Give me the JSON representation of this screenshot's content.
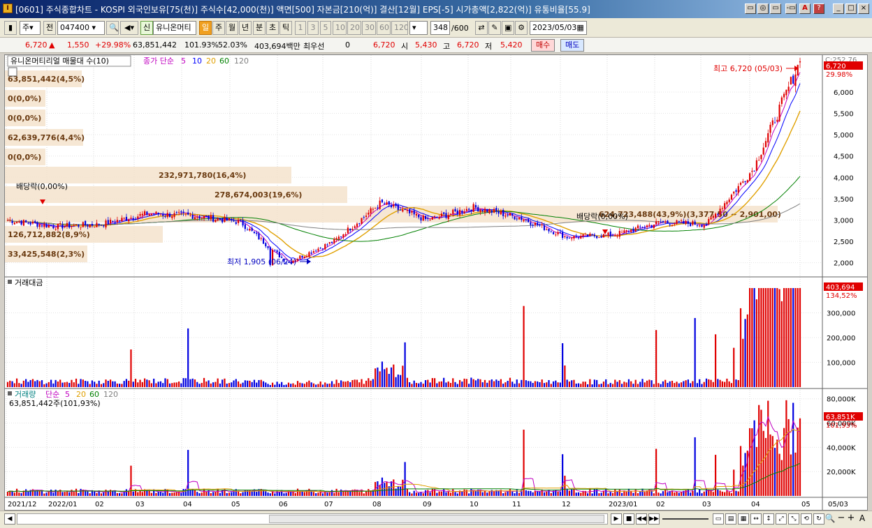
{
  "window": {
    "icon_label": "I",
    "title": "[0601] 주식종합차트 - KOSPI 외국인보유[75(천)] 주식수[42,000(천)] 액면[500] 자본금[210(억)] 결산[12월] EPS[-5] 시가총액[2,822(억)] 유통비율[55.9]",
    "buttons": [
      "▭",
      "◎",
      "▭",
      "-▭",
      "A",
      "?",
      "_",
      "□",
      "×"
    ]
  },
  "toolbar": {
    "stock_type": "주",
    "market": "전",
    "code": "047400",
    "stock_name_tag": "신",
    "stock_name": "유니온머티",
    "periods": [
      "일",
      "주",
      "월",
      "년",
      "분",
      "초",
      "틱"
    ],
    "selected_period": "일",
    "intervals": [
      "1",
      "3",
      "5",
      "10",
      "20",
      "30",
      "60",
      "120"
    ],
    "count": "348",
    "max_count": "/600",
    "date": "2023/05/03"
  },
  "quote": {
    "price": "6,720",
    "arrow": "▲",
    "change": "1,550",
    "change_pct": "+29.98%",
    "volume": "63,851,442",
    "vol_ratio": "101.93%",
    "turnover_ratio": "52.03%",
    "trade_value": "403,694백만",
    "prefer_label": "최우선",
    "prefer_value": "0",
    "best_ask": "6,720",
    "open_label": "시",
    "open": "5,430",
    "high_label": "고",
    "high": "6,720",
    "low_label": "저",
    "low": "5,420",
    "buy_label": "매수",
    "sell_label": "매도"
  },
  "price_panel": {
    "title": "유니온머티리얼 매물대 수(10)",
    "ma_label": "종가 단순",
    "ma_periods": [
      "5",
      "10",
      "20",
      "60",
      "120"
    ],
    "ma_colors": [
      "#c000c0",
      "#0000ff",
      "#e0a000",
      "#008000",
      "#808080"
    ],
    "axis_top_label": "C:252.76",
    "price_tag": "6,720",
    "pct_tag": "29.98%",
    "y_ticks": [
      "6,000",
      "5,500",
      "5,000",
      "4,500",
      "4,000",
      "3,500",
      "3,000",
      "2,500",
      "2,000"
    ],
    "volume_profile": [
      {
        "label": "63,851,442(4,5%)"
      },
      {
        "label": "0(0,0%)"
      },
      {
        "label": "0(0,0%)"
      },
      {
        "label": "62,639,776(4,4%)"
      },
      {
        "label": "0(0,0%)"
      },
      {
        "label": "232,971,780(16,4%)"
      },
      {
        "label": "278,674,003(19,6%)"
      },
      {
        "label": "624,723,488(43,9%)(3,377,50 ~ 2,901,00)"
      },
      {
        "label": "126,712,882(8,9%)"
      },
      {
        "label": "33,425,548(2,3%)"
      }
    ],
    "high_annotation": "최고 6,720 (05/03)",
    "low_annotation": "최저 1,905 (06/24)",
    "dividend_label_1": "배당락(0,00%)",
    "dividend_label_2": "배당락(0,00%)"
  },
  "value_panel": {
    "title": "거래대금",
    "value_tag": "403,694",
    "pct_tag": "134,52%",
    "y_ticks": [
      "300,000",
      "200,000",
      "100,000"
    ]
  },
  "volume_panel": {
    "title": "거래량",
    "ma_label": "단순",
    "ma_periods": [
      "5",
      "20",
      "60",
      "120"
    ],
    "value_text": "63,851,442주(101,93%)",
    "value_tag": "63,851K",
    "pct_tag": "101,93%",
    "y_ticks": [
      "80,000K",
      "60,000K",
      "40,000K",
      "20,000K"
    ]
  },
  "x_axis": {
    "labels": [
      "2021/12",
      "2022/01",
      "02",
      "03",
      "04",
      "05",
      "06",
      "07",
      "08",
      "09",
      "10",
      "11",
      "12",
      "2023/01",
      "02",
      "03",
      "04",
      "05",
      "05/03"
    ]
  },
  "chart_data": {
    "type": "candlestick",
    "symbol": "047400",
    "last_close": 6720,
    "period_high": {
      "value": 6720,
      "date": "05/03"
    },
    "period_low": {
      "value": 1905,
      "date": "06/24"
    },
    "price_ylim": [
      1700,
      6800
    ],
    "monthly_close_estimates": [
      {
        "m": "2021/12",
        "close": 3000
      },
      {
        "m": "2022/01",
        "close": 2850
      },
      {
        "m": "2022/02",
        "close": 2900
      },
      {
        "m": "2022/03",
        "close": 3150
      },
      {
        "m": "2022/04",
        "close": 3100
      },
      {
        "m": "2022/05",
        "close": 2950
      },
      {
        "m": "2022/06",
        "close": 2000
      },
      {
        "m": "2022/07",
        "close": 2500
      },
      {
        "m": "2022/08",
        "close": 3400
      },
      {
        "m": "2022/09",
        "close": 3000
      },
      {
        "m": "2022/10",
        "close": 3300
      },
      {
        "m": "2022/11",
        "close": 3050
      },
      {
        "m": "2022/12",
        "close": 2600
      },
      {
        "m": "2023/01",
        "close": 2650
      },
      {
        "m": "2023/02",
        "close": 2950
      },
      {
        "m": "2023/03",
        "close": 2900
      },
      {
        "m": "2023/04",
        "close": 4200
      },
      {
        "m": "2023/05",
        "close": 6720
      }
    ]
  }
}
